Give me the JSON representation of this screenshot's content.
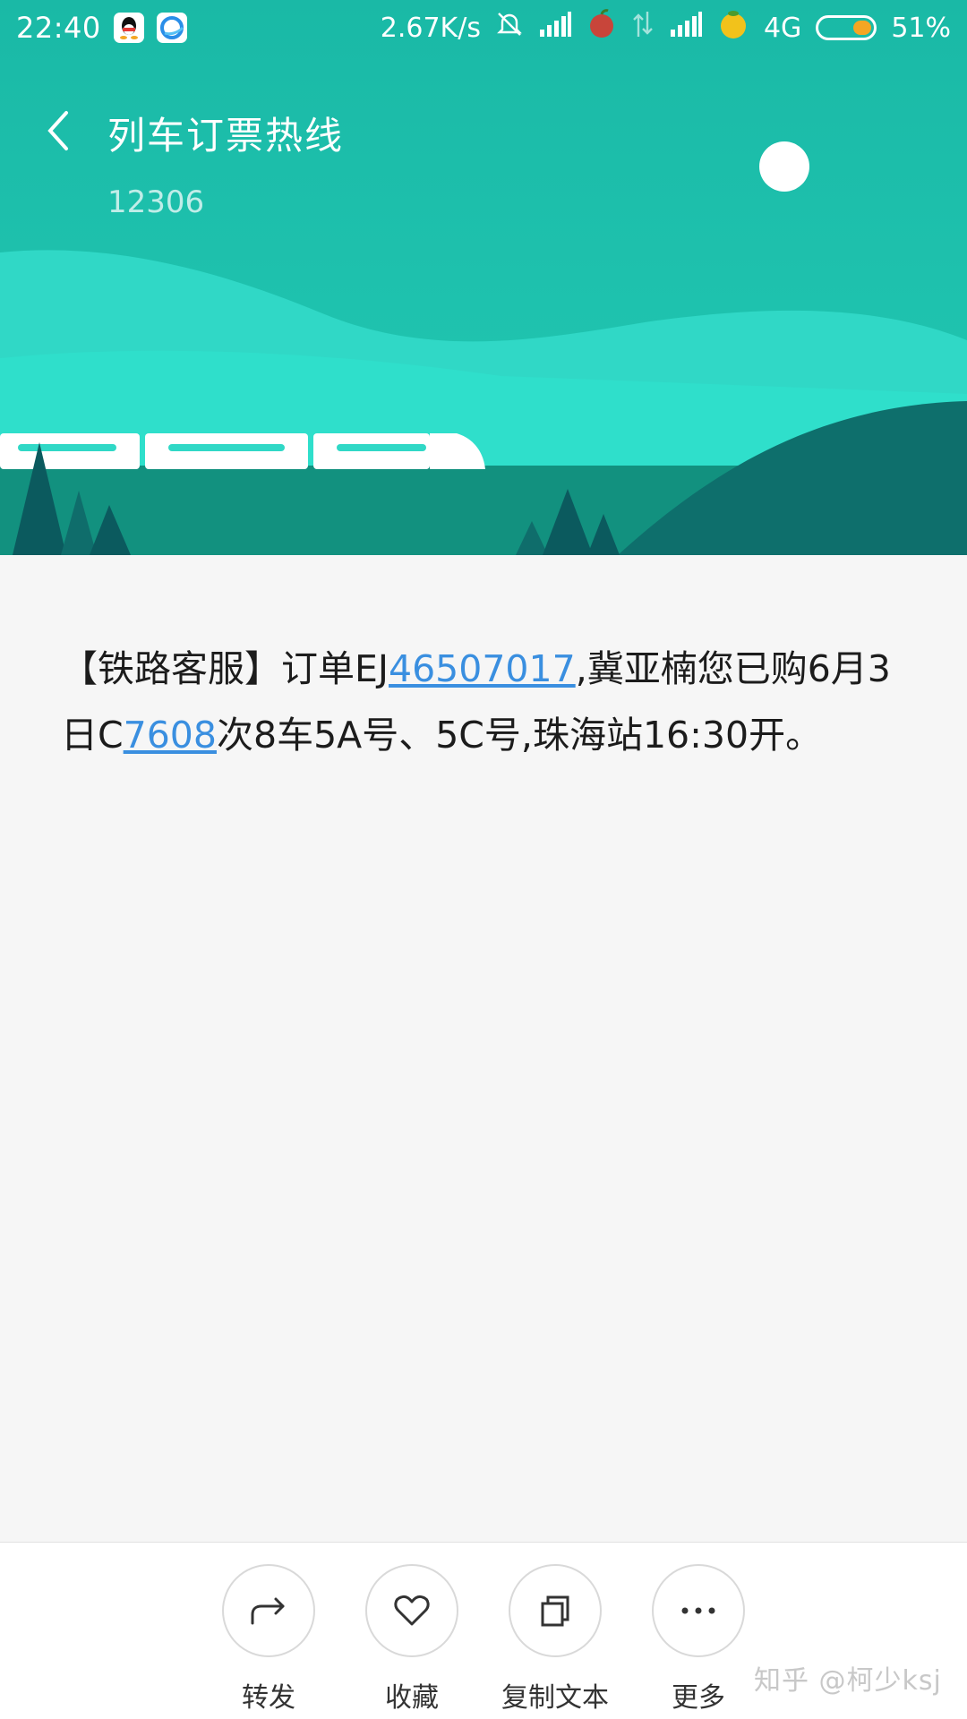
{
  "status_bar": {
    "time": "22:40",
    "speed": "2.67K/s",
    "network": "4G",
    "battery": "51%",
    "battery_level": 0.51,
    "icons": [
      "qq-icon",
      "browser-icon",
      "silent-icon",
      "signal-icon",
      "apple-icon",
      "data-arrows-icon",
      "signal-icon",
      "orange-icon"
    ]
  },
  "header": {
    "title": "列车订票热线",
    "subtitle": "12306"
  },
  "message": {
    "part1": "【铁路客服】订单EJ",
    "link1": "46507017",
    "part2": ",冀亚楠您已购6月3日C",
    "link2": "7608",
    "part3": "次8车5A号、5C号,珠海站16:30开。"
  },
  "actions": [
    {
      "label": "转发",
      "icon": "forward-icon"
    },
    {
      "label": "收藏",
      "icon": "heart-icon"
    },
    {
      "label": "复制文本",
      "icon": "copy-icon"
    },
    {
      "label": "更多",
      "icon": "more-icon"
    }
  ],
  "watermark": "知乎 @柯少ksj",
  "colors": {
    "header_teal": "#1cbca8",
    "link_blue": "#3a8fe0",
    "battery_orange": "#f5a623"
  }
}
